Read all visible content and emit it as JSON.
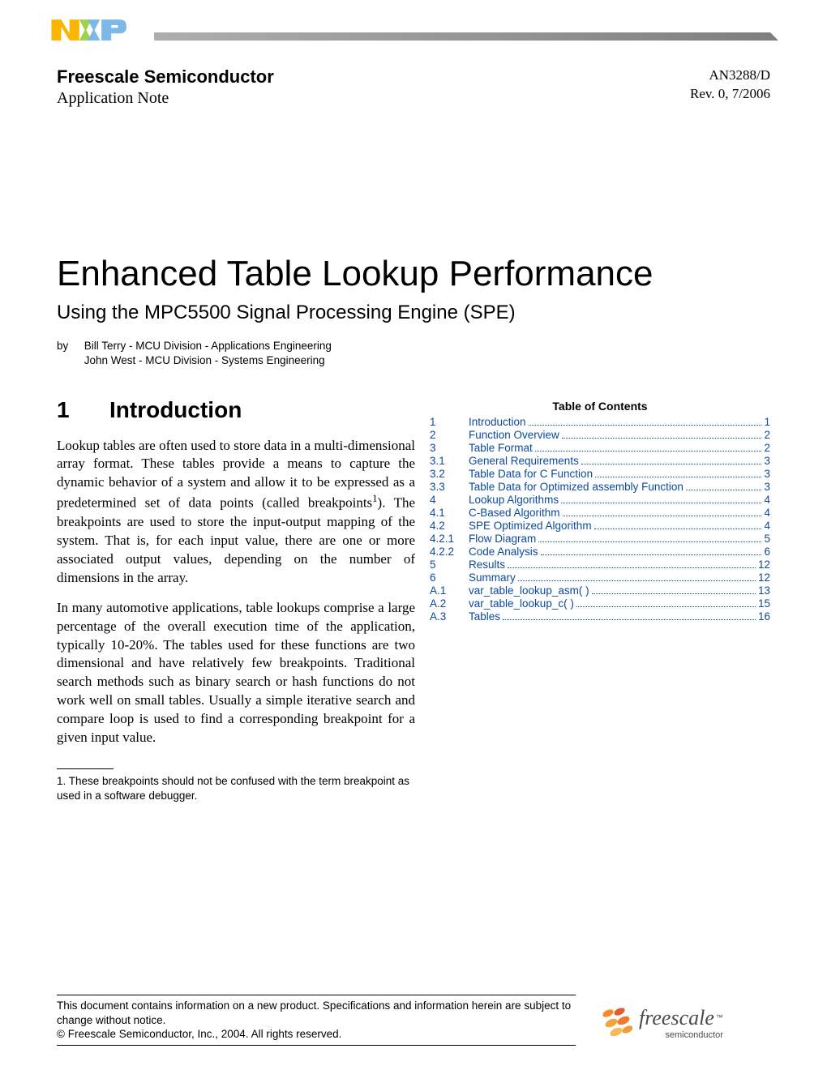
{
  "header": {
    "company": "Freescale Semiconductor",
    "note_type": "Application Note",
    "docnum": "AN3288/D",
    "rev": "Rev. 0, 7/2006"
  },
  "title": "Enhanced Table Lookup Performance",
  "subtitle": "Using the MPC5500 Signal Processing Engine (SPE)",
  "byline": {
    "by": "by",
    "line1": "Bill Terry - MCU Division - Applications Engineering",
    "line2": "John West - MCU Division - Systems Engineering"
  },
  "section1": {
    "num": "1",
    "title": "Introduction",
    "para1_a": "Lookup tables are often used to store data in a multi-dimensional array format. These tables provide a means to capture the dynamic behavior of a system and allow it to be expressed as a predetermined set of data points (called breakpoints",
    "para1_sup": "1",
    "para1_b": "). The breakpoints are used to store the input-output mapping of the system. That is, for each input value, there are one or more associated output values, depending on the number of dimensions in the array.",
    "para2": "In many automotive applications, table lookups comprise a large percentage of the overall execution time of the application, typically 10-20%. The tables used for these functions are two dimensional and have relatively few breakpoints. Traditional search methods such as binary search or hash functions do not work well on small tables. Usually a simple iterative search and compare loop is used to find a corresponding breakpoint for a given input value."
  },
  "toc_title": "Table of Contents",
  "toc": [
    {
      "num": "1",
      "label": "Introduction",
      "page": "1"
    },
    {
      "num": "2",
      "label": "Function Overview",
      "page": "2"
    },
    {
      "num": "3",
      "label": "Table Format",
      "page": "2"
    },
    {
      "num": "3.1",
      "label": "General Requirements ",
      "page": "3"
    },
    {
      "num": "3.2",
      "label": "Table Data for C Function ",
      "page": "3"
    },
    {
      "num": "3.3",
      "label": "Table Data for Optimized assembly Function ",
      "page": "3"
    },
    {
      "num": "4",
      "label": "Lookup Algorithms",
      "page": "4"
    },
    {
      "num": "4.1",
      "label": "C-Based Algorithm ",
      "page": "4"
    },
    {
      "num": "4.2",
      "label": "SPE Optimized Algorithm ",
      "page": "4"
    },
    {
      "num": "4.2.1",
      "label": "Flow Diagram",
      "page": "5"
    },
    {
      "num": "4.2.2",
      "label": "Code Analysis",
      "page": "6"
    },
    {
      "num": "5",
      "label": "Results",
      "page": "12"
    },
    {
      "num": "6",
      "label": "Summary ",
      "page": "12"
    },
    {
      "num": "A.1",
      "label": "var_table_lookup_asm( ) ",
      "page": "13"
    },
    {
      "num": "A.2",
      "label": "var_table_lookup_c( ) ",
      "page": "15"
    },
    {
      "num": "A.3",
      "label": "Tables ",
      "page": "16"
    }
  ],
  "footnote": "1. These breakpoints should not be confused with the term breakpoint as used in a software debugger.",
  "disclaimer1": "This document contains information on a new product. Specifications and information herein are subject to change without notice.",
  "disclaimer2": "© Freescale Semiconductor, Inc., 2004. All rights reserved.",
  "footer_logo": {
    "text": "freescale",
    "tm": "™",
    "sub": "semiconductor"
  }
}
